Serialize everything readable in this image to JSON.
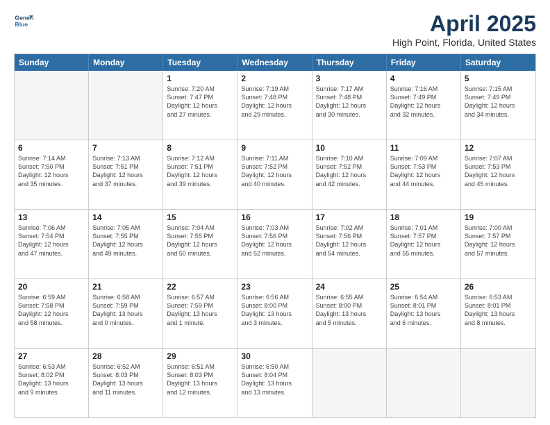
{
  "logo": {
    "line1": "General",
    "line2": "Blue"
  },
  "title": "April 2025",
  "location": "High Point, Florida, United States",
  "weekdays": [
    "Sunday",
    "Monday",
    "Tuesday",
    "Wednesday",
    "Thursday",
    "Friday",
    "Saturday"
  ],
  "weeks": [
    [
      {
        "day": "",
        "info": "",
        "shade": true
      },
      {
        "day": "",
        "info": "",
        "shade": true
      },
      {
        "day": "1",
        "info": "Sunrise: 7:20 AM\nSunset: 7:47 PM\nDaylight: 12 hours\nand 27 minutes."
      },
      {
        "day": "2",
        "info": "Sunrise: 7:19 AM\nSunset: 7:48 PM\nDaylight: 12 hours\nand 29 minutes."
      },
      {
        "day": "3",
        "info": "Sunrise: 7:17 AM\nSunset: 7:48 PM\nDaylight: 12 hours\nand 30 minutes."
      },
      {
        "day": "4",
        "info": "Sunrise: 7:16 AM\nSunset: 7:49 PM\nDaylight: 12 hours\nand 32 minutes."
      },
      {
        "day": "5",
        "info": "Sunrise: 7:15 AM\nSunset: 7:49 PM\nDaylight: 12 hours\nand 34 minutes."
      }
    ],
    [
      {
        "day": "6",
        "info": "Sunrise: 7:14 AM\nSunset: 7:50 PM\nDaylight: 12 hours\nand 35 minutes."
      },
      {
        "day": "7",
        "info": "Sunrise: 7:13 AM\nSunset: 7:51 PM\nDaylight: 12 hours\nand 37 minutes."
      },
      {
        "day": "8",
        "info": "Sunrise: 7:12 AM\nSunset: 7:51 PM\nDaylight: 12 hours\nand 39 minutes."
      },
      {
        "day": "9",
        "info": "Sunrise: 7:11 AM\nSunset: 7:52 PM\nDaylight: 12 hours\nand 40 minutes."
      },
      {
        "day": "10",
        "info": "Sunrise: 7:10 AM\nSunset: 7:52 PM\nDaylight: 12 hours\nand 42 minutes."
      },
      {
        "day": "11",
        "info": "Sunrise: 7:09 AM\nSunset: 7:53 PM\nDaylight: 12 hours\nand 44 minutes."
      },
      {
        "day": "12",
        "info": "Sunrise: 7:07 AM\nSunset: 7:53 PM\nDaylight: 12 hours\nand 45 minutes."
      }
    ],
    [
      {
        "day": "13",
        "info": "Sunrise: 7:06 AM\nSunset: 7:54 PM\nDaylight: 12 hours\nand 47 minutes."
      },
      {
        "day": "14",
        "info": "Sunrise: 7:05 AM\nSunset: 7:55 PM\nDaylight: 12 hours\nand 49 minutes."
      },
      {
        "day": "15",
        "info": "Sunrise: 7:04 AM\nSunset: 7:55 PM\nDaylight: 12 hours\nand 50 minutes."
      },
      {
        "day": "16",
        "info": "Sunrise: 7:03 AM\nSunset: 7:56 PM\nDaylight: 12 hours\nand 52 minutes."
      },
      {
        "day": "17",
        "info": "Sunrise: 7:02 AM\nSunset: 7:56 PM\nDaylight: 12 hours\nand 54 minutes."
      },
      {
        "day": "18",
        "info": "Sunrise: 7:01 AM\nSunset: 7:57 PM\nDaylight: 12 hours\nand 55 minutes."
      },
      {
        "day": "19",
        "info": "Sunrise: 7:00 AM\nSunset: 7:57 PM\nDaylight: 12 hours\nand 57 minutes."
      }
    ],
    [
      {
        "day": "20",
        "info": "Sunrise: 6:59 AM\nSunset: 7:58 PM\nDaylight: 12 hours\nand 58 minutes."
      },
      {
        "day": "21",
        "info": "Sunrise: 6:58 AM\nSunset: 7:59 PM\nDaylight: 13 hours\nand 0 minutes."
      },
      {
        "day": "22",
        "info": "Sunrise: 6:57 AM\nSunset: 7:59 PM\nDaylight: 13 hours\nand 1 minute."
      },
      {
        "day": "23",
        "info": "Sunrise: 6:56 AM\nSunset: 8:00 PM\nDaylight: 13 hours\nand 3 minutes."
      },
      {
        "day": "24",
        "info": "Sunrise: 6:55 AM\nSunset: 8:00 PM\nDaylight: 13 hours\nand 5 minutes."
      },
      {
        "day": "25",
        "info": "Sunrise: 6:54 AM\nSunset: 8:01 PM\nDaylight: 13 hours\nand 6 minutes."
      },
      {
        "day": "26",
        "info": "Sunrise: 6:53 AM\nSunset: 8:01 PM\nDaylight: 13 hours\nand 8 minutes."
      }
    ],
    [
      {
        "day": "27",
        "info": "Sunrise: 6:53 AM\nSunset: 8:02 PM\nDaylight: 13 hours\nand 9 minutes."
      },
      {
        "day": "28",
        "info": "Sunrise: 6:52 AM\nSunset: 8:03 PM\nDaylight: 13 hours\nand 11 minutes."
      },
      {
        "day": "29",
        "info": "Sunrise: 6:51 AM\nSunset: 8:03 PM\nDaylight: 13 hours\nand 12 minutes."
      },
      {
        "day": "30",
        "info": "Sunrise: 6:50 AM\nSunset: 8:04 PM\nDaylight: 13 hours\nand 13 minutes."
      },
      {
        "day": "",
        "info": "",
        "shade": true
      },
      {
        "day": "",
        "info": "",
        "shade": true
      },
      {
        "day": "",
        "info": "",
        "shade": true
      }
    ]
  ]
}
